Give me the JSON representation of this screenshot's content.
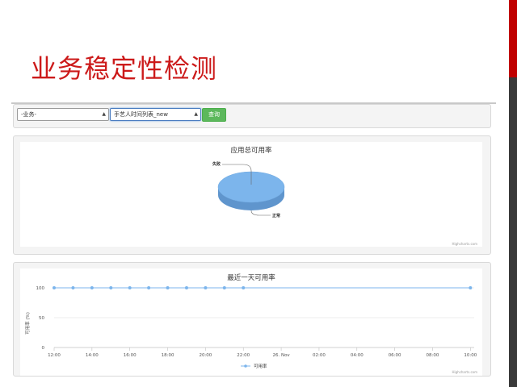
{
  "slide": {
    "title": "业务稳定性检测"
  },
  "filters": {
    "business_select": "-业务-",
    "table_select": "手艺人时间列表_new",
    "query_label": "查询"
  },
  "colors": {
    "title": "#cc1a1a",
    "series": "#7cb5ec",
    "button": "#5cb85c"
  },
  "chart_data": [
    {
      "type": "pie",
      "title": "应用总可用率",
      "slices": [
        {
          "label": "正常",
          "value": 100
        },
        {
          "label": "失败",
          "value": 0
        }
      ],
      "credit": "Highcharts.com"
    },
    {
      "type": "line",
      "title": "最近一天可用率",
      "ylabel": "可用率 (%)",
      "ylim": [
        0,
        100
      ],
      "yticks": [
        "0",
        "50",
        "100"
      ],
      "xticks": [
        "12:00",
        "14:00",
        "16:00",
        "18:00",
        "20:00",
        "22:00",
        "26. Nov",
        "02:00",
        "04:00",
        "06:00",
        "08:00",
        "10:00"
      ],
      "series": [
        {
          "name": "可用率",
          "x_hours": [
            12,
            13,
            14,
            15,
            16,
            17,
            18,
            19,
            20,
            21,
            22,
            34
          ],
          "values": [
            100,
            100,
            100,
            100,
            100,
            100,
            100,
            100,
            100,
            100,
            100,
            100
          ]
        }
      ],
      "credit": "Highcharts.com"
    }
  ]
}
